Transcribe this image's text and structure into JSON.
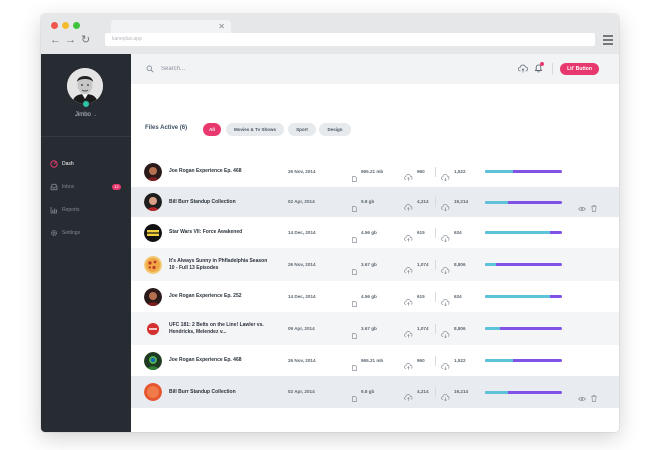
{
  "browser": {
    "url": "kaneplus.app",
    "colors": {
      "close": "#f0544b",
      "minimize": "#f5bb2f",
      "maximize": "#3fc33c"
    }
  },
  "user": {
    "name": "Jimbo",
    "status": "online"
  },
  "sidebar": {
    "items": [
      {
        "label": "Dash",
        "icon": "dashboard-icon",
        "active": true
      },
      {
        "label": "Inbox",
        "icon": "inbox-icon",
        "badge": "12"
      },
      {
        "label": "Reports",
        "icon": "chart-icon"
      },
      {
        "label": "Settings",
        "icon": "gear-icon"
      }
    ]
  },
  "search": {
    "placeholder": "Search..."
  },
  "header": {
    "button_label": "Lit' Button"
  },
  "files": {
    "title": "Files Active (6)",
    "filters": [
      "All",
      "Movies & Tv Shows",
      "Sport",
      "Design"
    ],
    "active_filter": "All"
  },
  "rows": [
    {
      "title": "Joe Rogan Experience Ep. 468",
      "date": "26 Nov, 2014",
      "size": "965.21 mb",
      "up": "960",
      "down": "1,522",
      "progress": 0.37,
      "thumb": "portrait-dark"
    },
    {
      "title": "Bill Burr Standup Collection",
      "date": "02 Apr, 2014",
      "size": "9.8 gb",
      "up": "4,214",
      "down": "19,214",
      "progress": 0.3,
      "thumb": "portrait-red",
      "actions": true
    },
    {
      "title": "Star Wars VII: Force Awakened",
      "date": "14 Dec, 2014",
      "size": "4.56 gb",
      "up": "615",
      "down": "634",
      "progress": 0.84,
      "thumb": "starwars-logo"
    },
    {
      "title": "It's Always Sunny in Phfladelphia Season 10 - Full 13 Episodes",
      "date": "26 Nov, 2014",
      "size": "3.67 gb",
      "up": "1,074",
      "down": "8,806",
      "progress": 0.14,
      "thumb": "pizza"
    },
    {
      "title": "Joe Rogan Experience Ep. 252",
      "date": "14 Dec, 2014",
      "size": "4.56 gb",
      "up": "615",
      "down": "634",
      "progress": 0.84,
      "thumb": "portrait-dark"
    },
    {
      "title": "UFC 181: 2 Belts on the Line! Lawler vs. Hendricks, Melendez v...",
      "date": "09 Apr, 2014",
      "size": "3.67 gb",
      "up": "1,074",
      "down": "8,806",
      "progress": 0.2,
      "thumb": "ufc-logo"
    },
    {
      "title": "Joe Rogan Experience Ep. 468",
      "date": "26 Nov, 2014",
      "size": "965.21 mb",
      "up": "960",
      "down": "1,522",
      "progress": 0.37,
      "thumb": "portrait-green"
    },
    {
      "title": "Bill Burr Standup Collection",
      "date": "02 Apr, 2014",
      "size": "9.8 gb",
      "up": "4,214",
      "down": "19,214",
      "progress": 0.3,
      "thumb": "orange-circle",
      "actions": true
    }
  ],
  "colors": {
    "accent": "#e8396e",
    "sidebar": "#272c33",
    "progress_a": "#5ec2d9",
    "progress_b": "#8052e6",
    "online": "#2ec4a4"
  }
}
